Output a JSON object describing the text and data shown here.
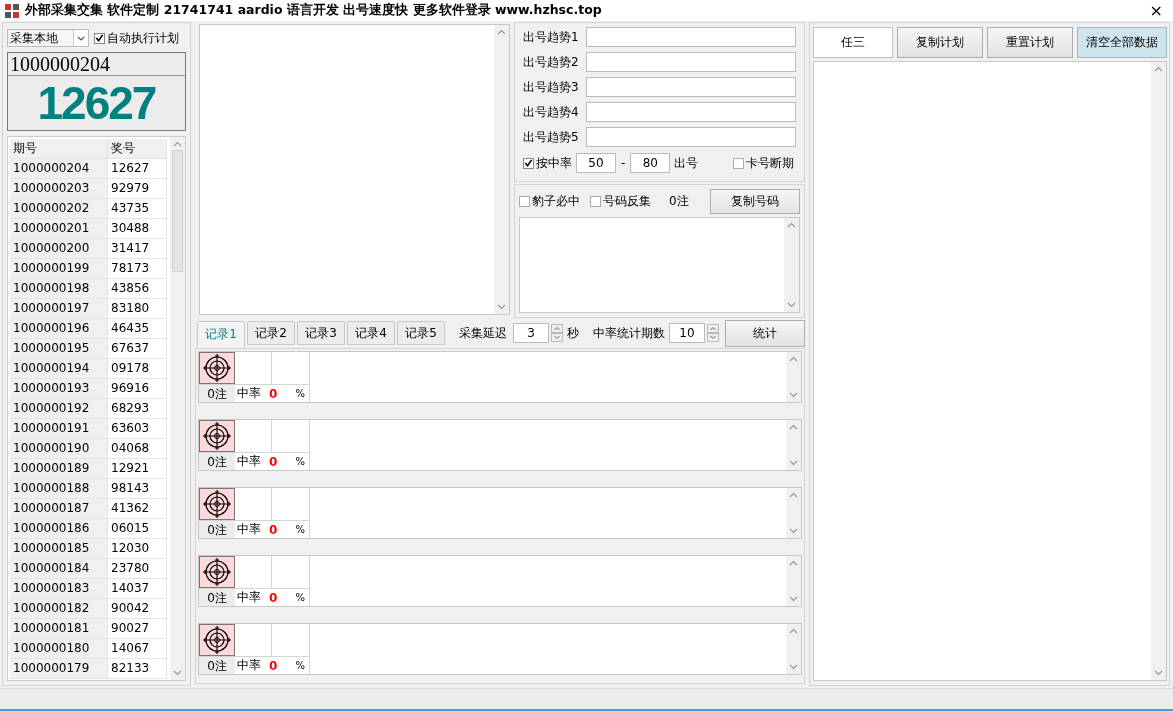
{
  "window": {
    "title": "外部采集交集 软件定制 21741741 aardio 语言开发 出号速度快 更多软件登录 www.hzhsc.top",
    "close": "×"
  },
  "source": {
    "value": "采集本地"
  },
  "auto_plan": {
    "label": "自动执行计划",
    "checked": true
  },
  "current": {
    "period": "1000000204",
    "number": "12627"
  },
  "history": {
    "columns": [
      "期号",
      "奖号"
    ],
    "rows": [
      [
        "1000000204",
        "12627"
      ],
      [
        "1000000203",
        "92979"
      ],
      [
        "1000000202",
        "43735"
      ],
      [
        "1000000201",
        "30488"
      ],
      [
        "1000000200",
        "31417"
      ],
      [
        "1000000199",
        "78173"
      ],
      [
        "1000000198",
        "43856"
      ],
      [
        "1000000197",
        "83180"
      ],
      [
        "1000000196",
        "46435"
      ],
      [
        "1000000195",
        "67637"
      ],
      [
        "1000000194",
        "09178"
      ],
      [
        "1000000193",
        "96916"
      ],
      [
        "1000000192",
        "68293"
      ],
      [
        "1000000191",
        "63603"
      ],
      [
        "1000000190",
        "04068"
      ],
      [
        "1000000189",
        "12921"
      ],
      [
        "1000000188",
        "98143"
      ],
      [
        "1000000187",
        "41362"
      ],
      [
        "1000000186",
        "06015"
      ],
      [
        "1000000185",
        "12030"
      ],
      [
        "1000000184",
        "23780"
      ],
      [
        "1000000183",
        "14037"
      ],
      [
        "1000000182",
        "90042"
      ],
      [
        "1000000181",
        "90027"
      ],
      [
        "1000000180",
        "14067"
      ],
      [
        "1000000179",
        "82133"
      ]
    ]
  },
  "trends": [
    {
      "label": "出号趋势1"
    },
    {
      "label": "出号趋势2"
    },
    {
      "label": "出号趋势3"
    },
    {
      "label": "出号趋势4"
    },
    {
      "label": "出号趋势5"
    }
  ],
  "hit_filter": {
    "label": "按中率",
    "checked": true,
    "min": "50",
    "sep": "-",
    "max": "80",
    "suffix": "出号"
  },
  "card_break": {
    "label": "卡号断期",
    "checked": false
  },
  "options": [
    {
      "label": "豹子必中",
      "checked": false
    },
    {
      "label": "号码反集",
      "checked": false
    }
  ],
  "count": "0注",
  "copy_numbers": "复制号码",
  "tabs": [
    {
      "label": "记录1",
      "selected": true
    },
    {
      "label": "记录2",
      "selected": false
    },
    {
      "label": "记录3",
      "selected": false
    },
    {
      "label": "记录4",
      "selected": false
    },
    {
      "label": "记录5",
      "selected": false
    }
  ],
  "delay": {
    "label": "采集延迟",
    "value": "3",
    "unit": "秒"
  },
  "stat_periods": {
    "label": "中率统计期数",
    "value": "10"
  },
  "stat_button": "统计",
  "records": [
    {
      "count": "0注",
      "rate_label": "中率",
      "rate": "0",
      "percent": "%"
    },
    {
      "count": "0注",
      "rate_label": "中率",
      "rate": "0",
      "percent": "%"
    },
    {
      "count": "0注",
      "rate_label": "中率",
      "rate": "0",
      "percent": "%"
    },
    {
      "count": "0注",
      "rate_label": "中率",
      "rate": "0",
      "percent": "%"
    },
    {
      "count": "0注",
      "rate_label": "中率",
      "rate": "0",
      "percent": "%"
    }
  ],
  "plan_buttons": [
    {
      "label": "任三",
      "kind": "field"
    },
    {
      "label": "复制计划",
      "kind": "button"
    },
    {
      "label": "重置计划",
      "kind": "button"
    },
    {
      "label": "清空全部数据",
      "kind": "hot"
    }
  ]
}
